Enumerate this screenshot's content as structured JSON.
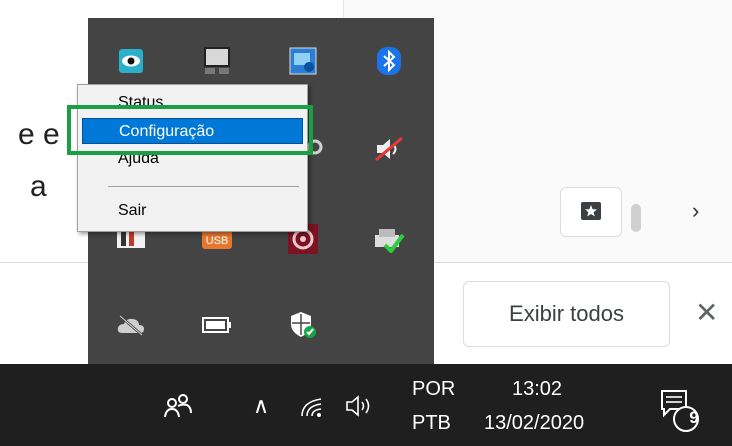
{
  "page": {
    "fragments": [
      "e e",
      "a"
    ]
  },
  "download_bar": {
    "show_all_label": "Exibir todos",
    "close_symbol": "✕",
    "next_symbol": "›"
  },
  "tray": {
    "icons": [
      "eye-icon",
      "monitor-icon",
      "intel-graphics-icon",
      "bluetooth-icon",
      "search-magnifier-icon",
      "muted-speaker-icon",
      "flag-icon",
      "usb-icon",
      "circle-target-icon",
      "printer-check-icon",
      "onedrive-cloud-icon",
      "battery-icon",
      "windows-security-icon"
    ]
  },
  "context_menu": {
    "items": [
      {
        "label": "Status"
      },
      {
        "label": "Configuração",
        "selected": true
      },
      {
        "label": "Ajuda"
      },
      {
        "label": "Sair"
      }
    ]
  },
  "taskbar": {
    "language_line1": "POR",
    "language_line2": "PTB",
    "time": "13:02",
    "date": "13/02/2020",
    "notification_count": "9",
    "chevron": "∧"
  },
  "colors": {
    "menu_selection": "#0078d7",
    "highlight_box": "#19a042",
    "tray_background": "#444444",
    "taskbar_background": "#1f1f1f"
  }
}
